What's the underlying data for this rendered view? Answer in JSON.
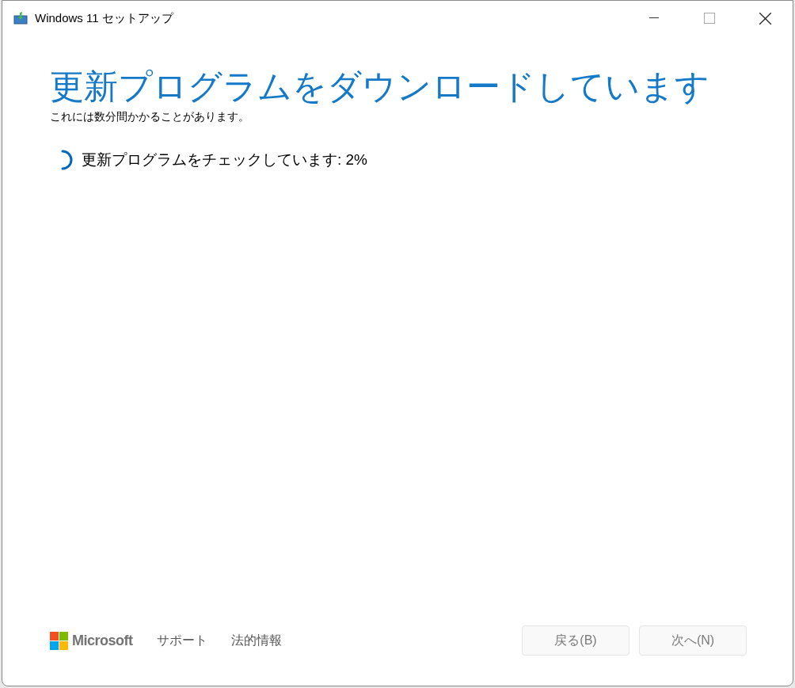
{
  "window": {
    "title": "Windows 11 セットアップ"
  },
  "heading": "更新プログラムをダウンロードしています",
  "subtitle": "これには数分間かかることがあります。",
  "status": "更新プログラムをチェックしています: 2%",
  "footer": {
    "brand": "Microsoft",
    "links": [
      "サポート",
      "法的情報"
    ]
  },
  "buttons": [
    {
      "label": "戻る(B)",
      "disabled": true
    },
    {
      "label": "次へ(N)",
      "disabled": true
    }
  ]
}
